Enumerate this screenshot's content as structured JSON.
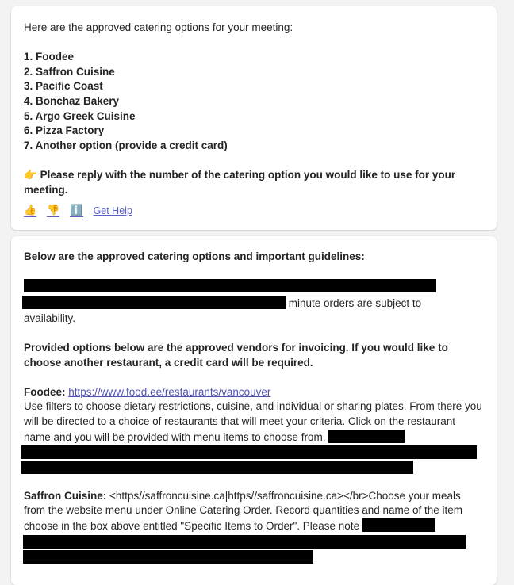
{
  "message1": {
    "intro": "Here are the approved catering options for your meeting:",
    "options": [
      "1. Foodee",
      "2. Saffron Cuisine",
      "3. Pacific Coast",
      "4. Bonchaz Bakery",
      "5. Argo Greek Cuisine",
      "6. Pizza Factory",
      "7. Another option (provide a credit card)"
    ],
    "prompt_emoji": "👉",
    "prompt": "Please reply with the number of the catering option you would like to use for your meeting.",
    "reactions": {
      "thumbs_up": "👍",
      "thumbs_down": "👎",
      "info": "ℹ️",
      "help": "Get Help"
    }
  },
  "message2": {
    "heading": "Below are the approved catering options and important guidelines:",
    "minute_orders_text": "minute orders are subject to",
    "availability_text": "availability.",
    "provided_options_text": "Provided options below are the approved vendors for invoicing. If you would like to choose another restaurant, a credit card will be required.",
    "foodee": {
      "label": "Foodee:",
      "url": "https://www.food.ee/restaurants/vancouver",
      "description": "Use filters to choose dietary restrictions, cuisine, and individual or sharing plates.  From there you will be directed to a choice of restaurants that will meet your criteria.  Click on the restaurant name and you will be provided with menu items to choose from."
    },
    "saffron": {
      "label": "Saffron Cuisine:",
      "link_text": "<https//saffroncuisine.ca|https//saffroncuisine.ca></br>",
      "description": "Choose your meals from the website menu under Online Catering Order. Record quantities and name of the item choose in the box above entitled \"Specific Items to Order\". Please note"
    }
  },
  "colors": {
    "background": "#f3f3f3",
    "card": "#ffffff",
    "link": "#4f52b2",
    "redaction": "#000000"
  }
}
